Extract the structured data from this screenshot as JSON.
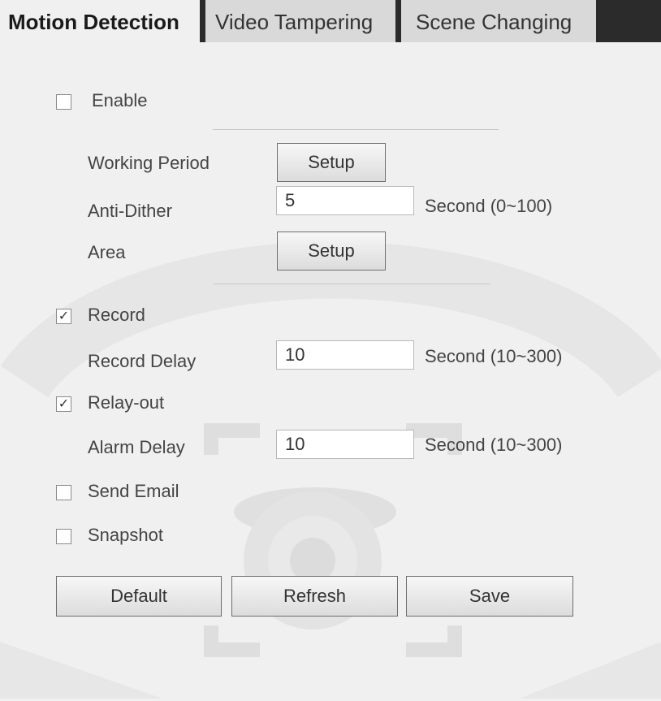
{
  "tabs": [
    "Motion Detection",
    "Video Tampering",
    "Scene Changing"
  ],
  "enable": {
    "label": "Enable",
    "checked": false
  },
  "working_period": {
    "label": "Working Period",
    "button": "Setup"
  },
  "anti_dither": {
    "label": "Anti-Dither",
    "value": "5",
    "unit": "Second (0~100)"
  },
  "area": {
    "label": "Area",
    "button": "Setup"
  },
  "record": {
    "label": "Record",
    "checked": true
  },
  "record_delay": {
    "label": "Record Delay",
    "value": "10",
    "unit": "Second (10~300)"
  },
  "relay_out": {
    "label": "Relay-out",
    "checked": true
  },
  "alarm_delay": {
    "label": "Alarm Delay",
    "value": "10",
    "unit": "Second (10~300)"
  },
  "send_email": {
    "label": "Send Email",
    "checked": false
  },
  "snapshot": {
    "label": "Snapshot",
    "checked": false
  },
  "buttons": {
    "default": "Default",
    "refresh": "Refresh",
    "save": "Save"
  },
  "check_mark": "✓"
}
